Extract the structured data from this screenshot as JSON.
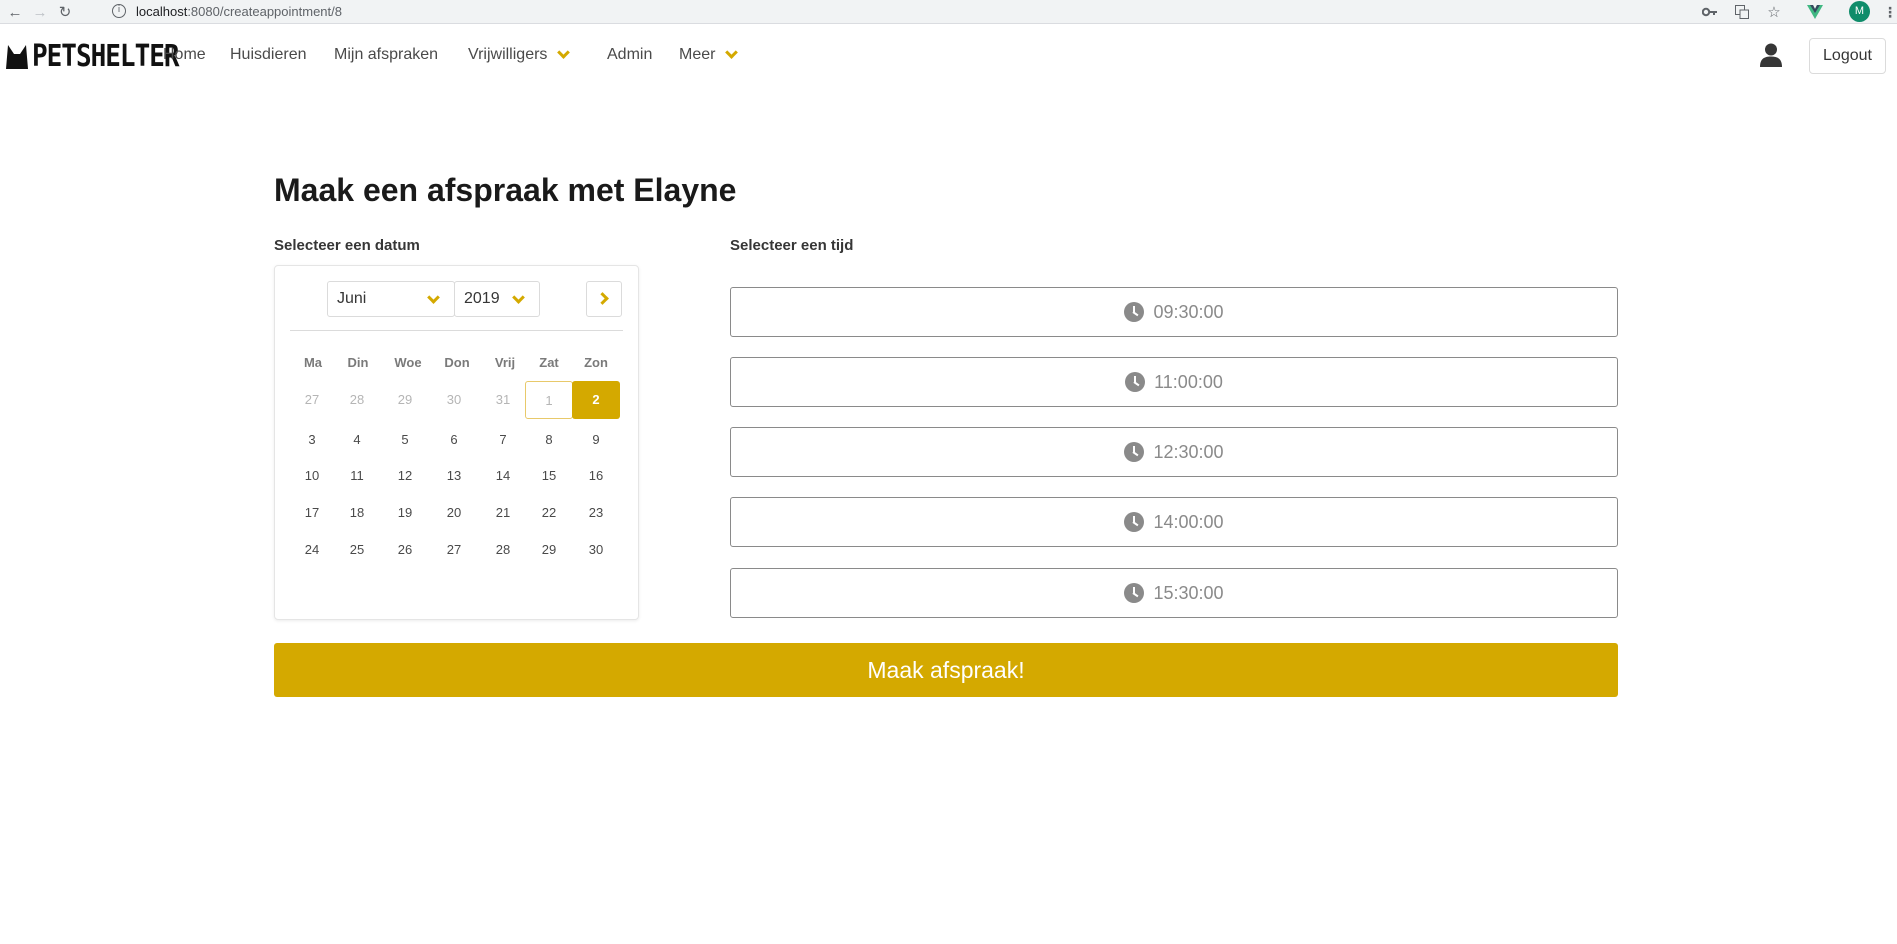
{
  "browser": {
    "url_host": "localhost",
    "url_path": ":8080/createappointment/8",
    "profile_initial": "M"
  },
  "navbar": {
    "logo_text": "PETSHELTER",
    "items": [
      {
        "label": "Home",
        "dropdown": false
      },
      {
        "label": "Huisdieren",
        "dropdown": false
      },
      {
        "label": "Mijn afspraken",
        "dropdown": false
      },
      {
        "label": "Vrijwilligers",
        "dropdown": true
      },
      {
        "label": "Admin",
        "dropdown": false
      },
      {
        "label": "Meer",
        "dropdown": true
      }
    ],
    "logout_label": "Logout"
  },
  "page": {
    "title": "Maak een afspraak met Elayne",
    "date_label": "Selecteer een datum",
    "time_label": "Selecteer een tijd",
    "submit_label": "Maak afspraak!"
  },
  "calendar": {
    "month": "Juni",
    "year": "2019",
    "weekdays": [
      "Ma",
      "Din",
      "Woe",
      "Don",
      "Vrij",
      "Zat",
      "Zon"
    ],
    "weeks": [
      [
        "27",
        "28",
        "29",
        "30",
        "31",
        "1",
        "2"
      ],
      [
        "3",
        "4",
        "5",
        "6",
        "7",
        "8",
        "9"
      ],
      [
        "10",
        "11",
        "12",
        "13",
        "14",
        "15",
        "16"
      ],
      [
        "17",
        "18",
        "19",
        "20",
        "21",
        "22",
        "23"
      ],
      [
        "24",
        "25",
        "26",
        "27",
        "28",
        "29",
        "30"
      ]
    ],
    "selected_day": "2",
    "today_day": "1"
  },
  "time_slots": [
    "09:30:00",
    "11:00:00",
    "12:30:00",
    "14:00:00",
    "15:30:00"
  ],
  "colors": {
    "accent": "#d4a900"
  }
}
